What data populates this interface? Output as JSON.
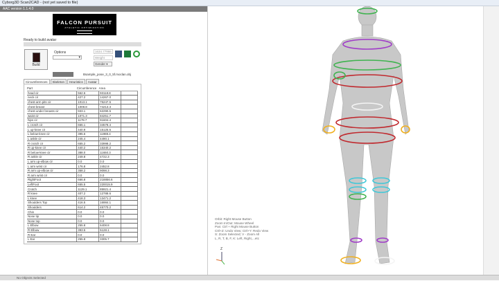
{
  "window": {
    "title": "Cyborg3D Scan2CAD - (not yet saved to file)"
  },
  "panel": {
    "title": "AAC version 1.1.4.0"
  },
  "logo": {
    "text": "FALCON PURSUIT",
    "subtext": "ATHLETIC OPTIMIZATION"
  },
  "status": "Ready to build avatar",
  "progress": 0,
  "build": {
    "label": "Build"
  },
  "options": {
    "label": "Options",
    "value": ""
  },
  "height_field": "1634.77966",
  "weight_field": "Weight",
  "gender": "Gender",
  "icons": [
    "save-icon",
    "excel-icon",
    "refresh-icon"
  ],
  "filename": "Bsample_pose_3_0_5f.moclan.obj",
  "tabs": [
    {
      "label": "Circumferences",
      "active": true
    },
    {
      "label": "Skeleton"
    },
    {
      "label": "Heuristics"
    },
    {
      "label": "Avatar"
    }
  ],
  "table": {
    "columns": [
      "Part",
      "Circumference",
      "Area"
    ],
    "rows": [
      [
        "head cir",
        "562.6",
        "93118.8"
      ],
      [
        "neck cir",
        "427.2",
        "14267.0"
      ],
      [
        "chest-arm pits cir",
        "1013.1",
        "75247.5"
      ],
      [
        "chest-breast",
        "1008.8",
        "74213.3"
      ],
      [
        "chest-under breasts cir",
        "933.1",
        "62290.5"
      ],
      [
        "waist cir",
        "1071.3",
        "84251.7"
      ],
      [
        "hips cir",
        "1178.7",
        "91604.4"
      ],
      [
        "L crotch cir",
        "655.1",
        "34578.4"
      ],
      [
        "L up-knee cir",
        "440.9",
        "15125.6"
      ],
      [
        "L below-knee cir",
        "395.6",
        "11988.4"
      ],
      [
        "L ankle cir",
        "245.4",
        "4490.1"
      ],
      [
        "R crotch cir",
        "655.2",
        "33998.2"
      ],
      [
        "R up-knee cir",
        "440.2",
        "15340.2"
      ],
      [
        "R below-knee cir",
        "388.0",
        "11650.3"
      ],
      [
        "R ankle cir",
        "249.8",
        "4722.3"
      ],
      [
        "L arm up-elbow cir",
        "0.0",
        "0.0"
      ],
      [
        "L arm wrist cir",
        "176.8",
        "2452.8"
      ],
      [
        "R arm up-elbow cir",
        "358.2",
        "9098.3"
      ],
      [
        "R arm wrist cir",
        "0.0",
        "0.0"
      ],
      [
        "RightFoot",
        "666.8",
        "218856.6"
      ],
      [
        "LeftFoot",
        "655.5",
        "220015.9"
      ],
      [
        "Crotch",
        "1129.1",
        "85921.4"
      ],
      [
        "R knee",
        "407.2",
        "12788.6"
      ],
      [
        "L knee",
        "418.3",
        "13471.2"
      ],
      [
        "Shoulders Top",
        "416.5",
        "16984.1"
      ],
      [
        "Shoulders",
        "614.2",
        "45770.2"
      ],
      [
        "Chin",
        "0.0",
        "0.0"
      ],
      [
        "Nose tip",
        "0.0",
        "0.0"
      ],
      [
        "Nose top",
        "0.0",
        "0.0"
      ],
      [
        "L Elbow",
        "255.8",
        "6408.8"
      ],
      [
        "R Elbow",
        "393.5",
        "5128.1"
      ],
      [
        "R Ear",
        "0.0",
        "0.0"
      ],
      [
        "L Ear",
        "255.8",
        "3305.7"
      ]
    ]
  },
  "help": [
    "Orbit: Right Mouse Button",
    "Zoom In/Out: Mouse Wheel",
    "Pan: Ctrl + Right Mouse Button",
    "Ctrl+Z: Undo View; Ctrl+Y: Redo View",
    "S: Zoom Selected; V - Zoom All",
    "L, R, T, B, F, K: Left, Right,...etc"
  ],
  "axis_label": "Z",
  "statusbar": "No Objects Selected",
  "ring_colors": {
    "green": "#3fb34f",
    "purple": "#a03cc8",
    "red": "#c0282d",
    "yellow": "#f0b020",
    "cyan": "#40c8d8",
    "white": "#f4f4f4"
  }
}
